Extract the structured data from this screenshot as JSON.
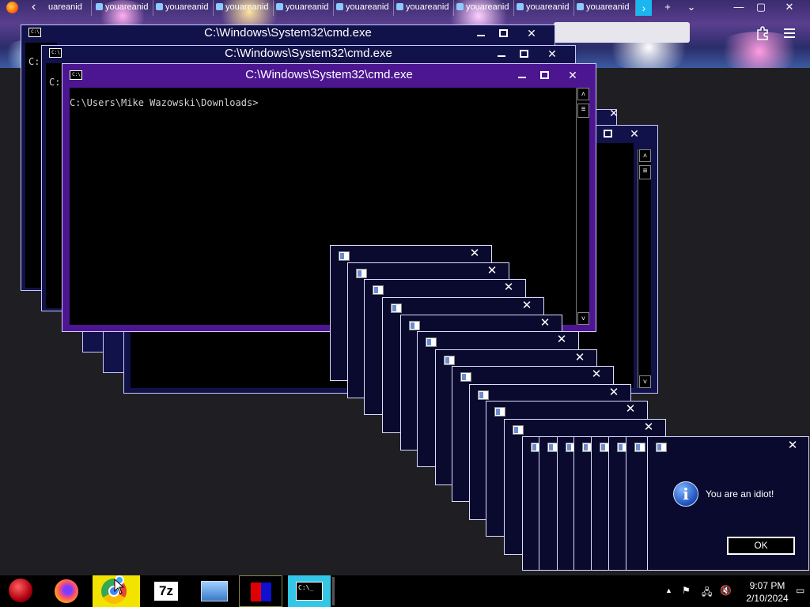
{
  "browser": {
    "tabs": [
      "uareanid",
      "youareanid",
      "youareanid",
      "youareanid",
      "youareanid",
      "youareanid",
      "youareanid",
      "youareanid",
      "youareanid",
      "youareanid"
    ],
    "back_glyph": "‹",
    "new_tab_glyph": "+",
    "dropdown_glyph": "⌄",
    "minimize_glyph": "—",
    "restore_glyph": "▢",
    "close_glyph": "✕",
    "extension_icon": "puzzle-icon",
    "menu_icon": "hamburger-icon"
  },
  "cmd_windows": {
    "title": "C:\\Windows\\System32\\cmd.exe",
    "prompt": "C:\\Users\\Mike Wazowski\\Downloads>",
    "partial_prompt": "C:"
  },
  "dialog": {
    "message": "You are an idiot!",
    "ok_label": "OK",
    "close_glyph": "✕"
  },
  "taskbar": {
    "cmd_label": "C:\\_",
    "sevenzip_label": "7z",
    "time": "9:07 PM",
    "date": "2/10/2024",
    "tray_up": "▲"
  },
  "colors": {
    "active_title": "#4b1690",
    "window_bg": "#12124a",
    "desktop": "#1f1f23"
  }
}
